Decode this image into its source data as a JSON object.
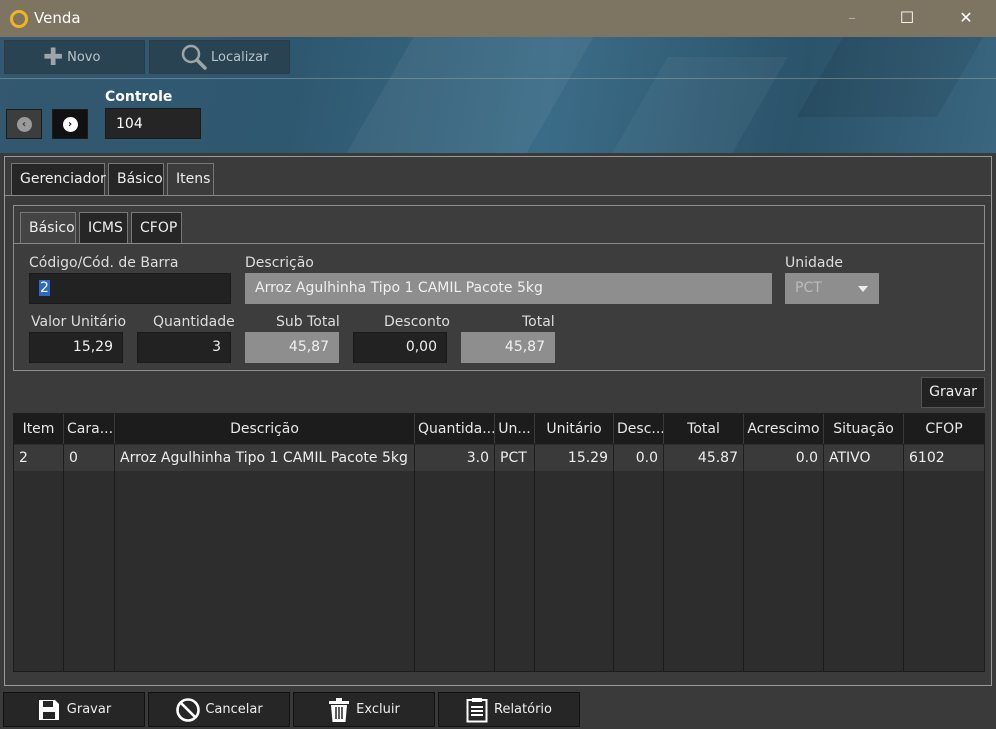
{
  "window": {
    "title": "Venda",
    "minimize": "–",
    "maximize": "☐",
    "close": "✕"
  },
  "toolbar": {
    "novo": "Novo",
    "localizar": "Localizar"
  },
  "nav": {
    "prev": "‹",
    "next": "›"
  },
  "controle": {
    "label": "Controle",
    "value": "104"
  },
  "tabs": [
    "Gerenciador",
    "Básico",
    "Itens"
  ],
  "subtabs": [
    "Básico",
    "ICMS",
    "CFOP"
  ],
  "form": {
    "codigo_label": "Código/Cód. de Barra",
    "codigo_value": "2",
    "descricao_label": "Descrição",
    "descricao_value": "Arroz Agulhinha Tipo 1 CAMIL Pacote 5kg",
    "unidade_label": "Unidade",
    "unidade_value": "PCT",
    "valor_unitario_label": "Valor Unitário",
    "valor_unitario_value": "15,29",
    "quantidade_label": "Quantidade",
    "quantidade_value": "3",
    "subtotal_label": "Sub Total",
    "subtotal_value": "45,87",
    "desconto_label": "Desconto",
    "desconto_value": "0,00",
    "total_label": "Total",
    "total_value": "45,87",
    "gravar_label": "Gravar"
  },
  "table": {
    "headers": [
      "Item",
      "Cara...",
      "Descrição",
      "Quantida...",
      "Un...",
      "Unitário",
      "Desc...",
      "Total",
      "Acrescimo",
      "Situação",
      "CFOP"
    ],
    "rows": [
      [
        "2",
        "0",
        "Arroz Agulhinha Tipo 1 CAMIL Pacote 5kg",
        "3.0",
        "PCT",
        "15.29",
        "0.0",
        "45.87",
        "0.0",
        "ATIVO",
        "6102"
      ]
    ]
  },
  "bottom": {
    "gravar": "Gravar",
    "cancelar": "Cancelar",
    "excluir": "Excluir",
    "relatorio": "Relatório"
  },
  "colors": {
    "titlebar": "#7d7461",
    "logo_ring": "#f2b51d",
    "header_blue": "#2e5870",
    "panel": "#3b3b3b"
  }
}
